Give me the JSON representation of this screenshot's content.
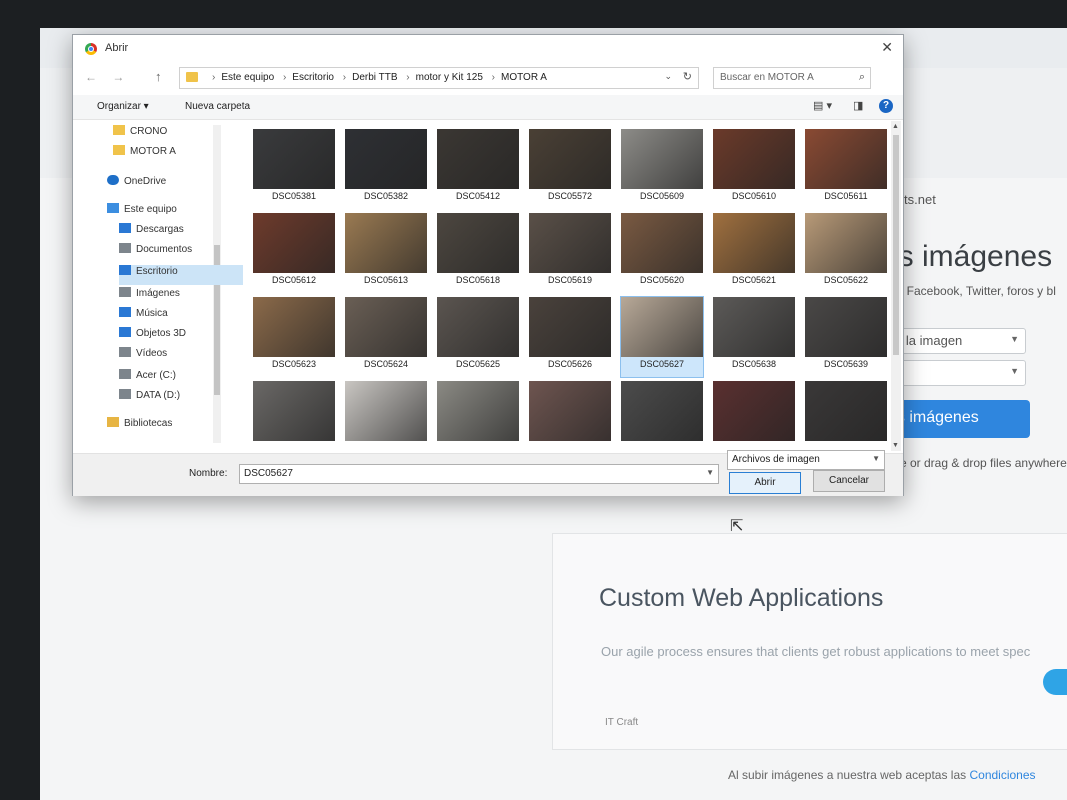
{
  "dialog": {
    "title": "Abrir",
    "close_glyph": "✕",
    "nav_arrows": "← →",
    "up_glyph": "↑",
    "breadcrumb": [
      "Este equipo",
      "Escritorio",
      "Derbi TTB",
      "motor y Kit 125",
      "MOTOR A"
    ],
    "search_placeholder": "Buscar en MOTOR A",
    "toolbar": {
      "organize": "Organizar ▾",
      "new_folder": "Nueva carpeta"
    },
    "sidebar": [
      {
        "label": "CRONO",
        "icon": "folder-icon"
      },
      {
        "label": "MOTOR A",
        "icon": "folder-icon"
      },
      {
        "label": "OneDrive",
        "icon": "cloud-icon"
      },
      {
        "label": "Este equipo",
        "icon": "computer-icon"
      },
      {
        "label": "Descargas",
        "icon": "download-icon"
      },
      {
        "label": "Documentos",
        "icon": "document-icon"
      },
      {
        "label": "Escritorio",
        "icon": "desktop-icon",
        "selected": true
      },
      {
        "label": "Imágenes",
        "icon": "pictures-icon"
      },
      {
        "label": "Música",
        "icon": "music-icon"
      },
      {
        "label": "Objetos 3D",
        "icon": "cube-icon"
      },
      {
        "label": "Vídeos",
        "icon": "video-icon"
      },
      {
        "label": "Acer (C:)",
        "icon": "drive-icon"
      },
      {
        "label": "DATA (D:)",
        "icon": "drive-icon"
      },
      {
        "label": "Bibliotecas",
        "icon": "library-icon"
      }
    ],
    "files": [
      {
        "name": "DSC05381",
        "color": "#3a3b3d"
      },
      {
        "name": "DSC05382",
        "color": "#2e3034"
      },
      {
        "name": "DSC05412",
        "color": "#3b3733"
      },
      {
        "name": "DSC05572",
        "color": "#4a4035"
      },
      {
        "name": "DSC05609",
        "color": "#8d8c88"
      },
      {
        "name": "DSC05610",
        "color": "#6b3a2a"
      },
      {
        "name": "DSC05611",
        "color": "#8a4a33"
      },
      {
        "name": "DSC05612",
        "color": "#6e3b2c"
      },
      {
        "name": "DSC05613",
        "color": "#9a7a52"
      },
      {
        "name": "DSC05618",
        "color": "#4d4740"
      },
      {
        "name": "DSC05619",
        "color": "#5a5048"
      },
      {
        "name": "DSC05620",
        "color": "#7a5a42"
      },
      {
        "name": "DSC05621",
        "color": "#a0703f"
      },
      {
        "name": "DSC05622",
        "color": "#b89a78"
      },
      {
        "name": "DSC05623",
        "color": "#8b6a4a"
      },
      {
        "name": "DSC05624",
        "color": "#6a5f55"
      },
      {
        "name": "DSC05625",
        "color": "#5b5550"
      },
      {
        "name": "DSC05626",
        "color": "#4a423c"
      },
      {
        "name": "DSC05627",
        "color": "#b8a998",
        "selected": true
      },
      {
        "name": "DSC05638",
        "color": "#5c5a58"
      },
      {
        "name": "DSC05639",
        "color": "#4a4847"
      },
      {
        "name": "",
        "color": "#6a6866"
      },
      {
        "name": "",
        "color": "#c9c6c2"
      },
      {
        "name": "",
        "color": "#8b8a84"
      },
      {
        "name": "",
        "color": "#6e5550"
      },
      {
        "name": "",
        "color": "#4c4c4c"
      },
      {
        "name": "",
        "color": "#5a3030"
      },
      {
        "name": "",
        "color": "#3a3838"
      }
    ],
    "name_label": "Nombre:",
    "file_name_value": "DSC05627",
    "filter_value": "Archivos de imagen",
    "open_label": "Abrir",
    "cancel_label": "Cancelar"
  },
  "background_page": {
    "domain_fragment": "eports.net",
    "heading_fragment": "us imágenes",
    "sub_fragment": "ara Facebook, Twitter, foros y bl",
    "select1": "o de la imagen",
    "upload_button": "as imágenes",
    "drag_text": "e or drag & drop files anywhere",
    "card_title": "Custom Web Applications",
    "card_desc": "Our agile process ensures that clients get robust applications to meet spec",
    "card_tag": "IT Craft",
    "footer_text": "Al subir imágenes a nuestra web aceptas las",
    "footer_link": "Condiciones"
  }
}
